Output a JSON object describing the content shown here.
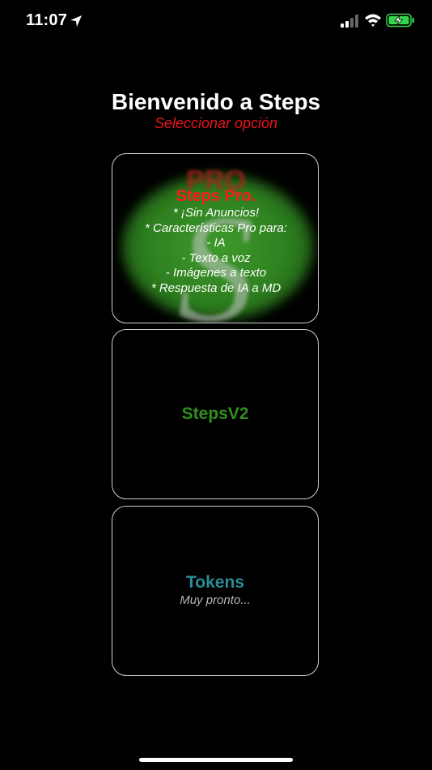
{
  "status_bar": {
    "time": "11:07",
    "icons": [
      "location-arrow-icon",
      "cellular-signal-icon",
      "wifi-icon",
      "battery-charging-icon"
    ],
    "battery_color": "#32d74b"
  },
  "header": {
    "title": "Bienvenido a Steps",
    "subtitle": "Seleccionar opción"
  },
  "cards": {
    "pro": {
      "title": "Steps Pro.",
      "features": [
        "* ¡Sin Anuncios!",
        "* Características Pro para:",
        "- IA",
        "- Texto a voz",
        "- Imágenes a texto",
        "* Respuesta de IA a MD"
      ],
      "logo_text": "PRO",
      "logo_letter": "S"
    },
    "v2": {
      "title": "StepsV2"
    },
    "tokens": {
      "title": "Tokens",
      "subtitle": "Muy pronto..."
    }
  },
  "colors": {
    "background": "#000000",
    "accent_red": "#e8141b",
    "pro_green": "#2e8a22",
    "v2_green": "#2f8f1f",
    "tokens_teal": "#2a8d96",
    "card_border": "#cfcfcf"
  }
}
